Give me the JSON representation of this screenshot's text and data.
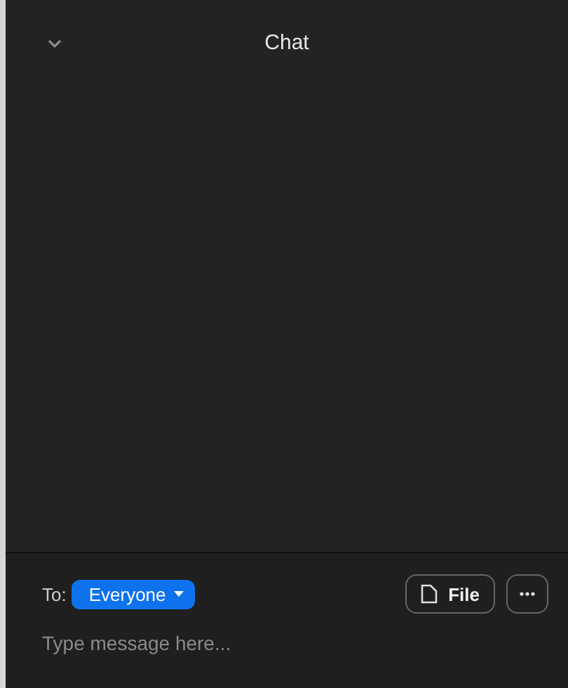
{
  "header": {
    "title": "Chat"
  },
  "composer": {
    "to_label": "To:",
    "recipient": "Everyone",
    "file_button": "File",
    "input": {
      "placeholder": "Type message here..."
    }
  }
}
